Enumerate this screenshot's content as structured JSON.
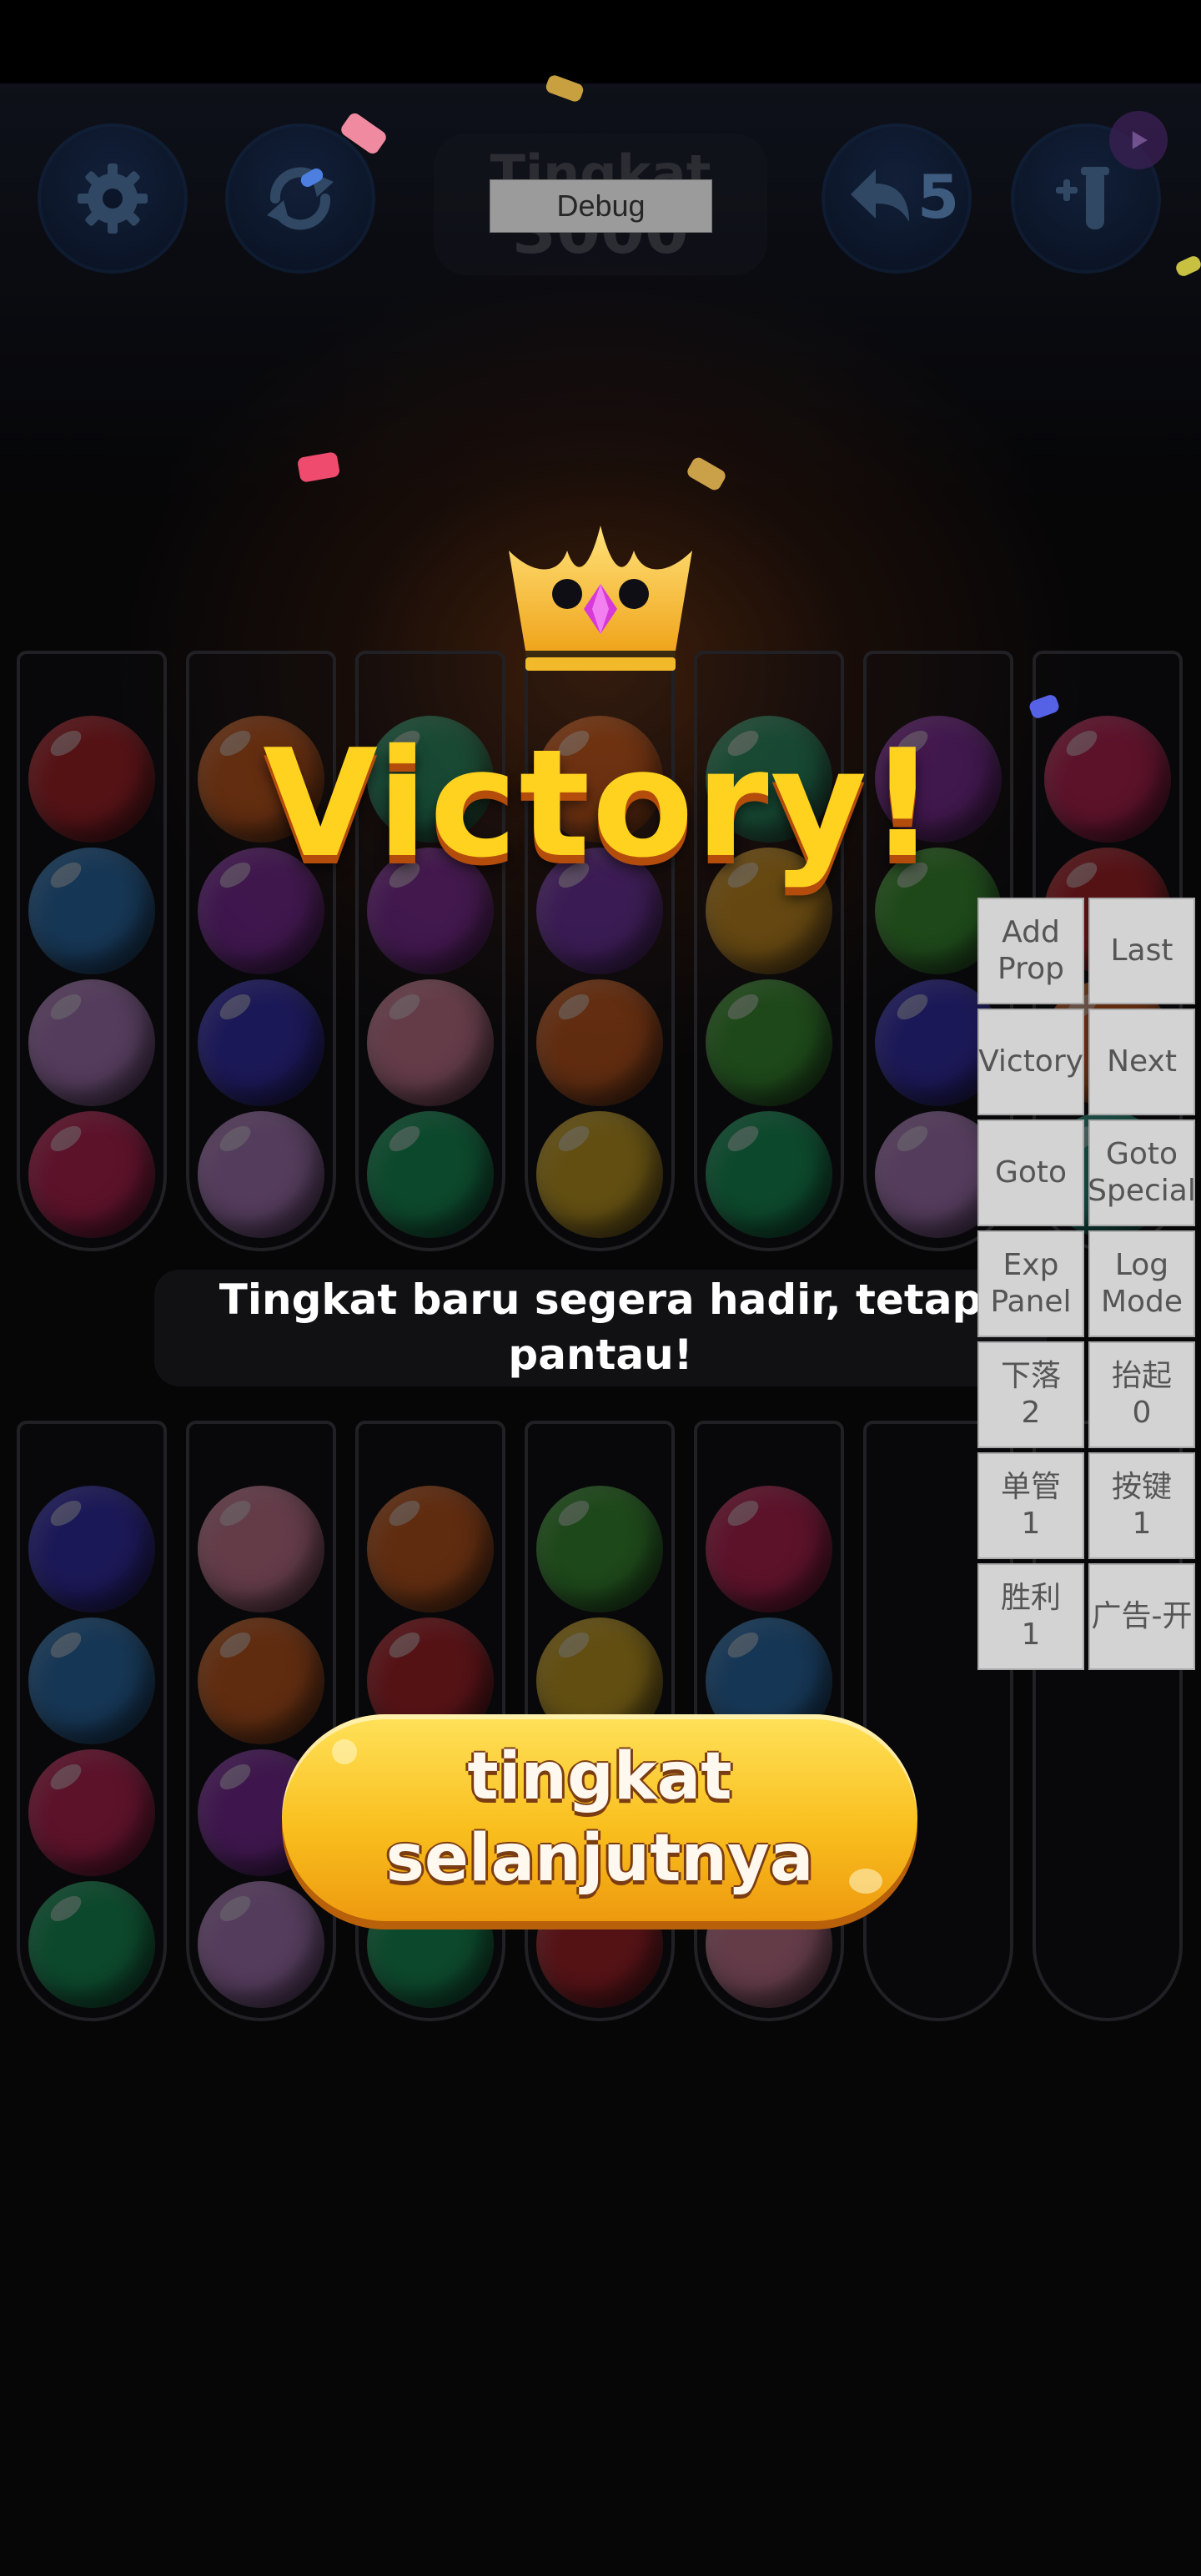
{
  "header": {
    "level_title": "Tingkat",
    "level_number": "3000",
    "undo_count": "5",
    "debug_label": "Debug",
    "icons": [
      "gear-icon",
      "restart-icon",
      "undo-icon",
      "add-tube-icon",
      "play-ad-icon"
    ]
  },
  "victory": {
    "title": "Victory!",
    "subtitle": "Tingkat baru segera hadir, tetap pantau!",
    "next_button": "tingkat selanjutnya"
  },
  "debug_panel": {
    "add_prop": "Add Prop",
    "last": "Last",
    "victory": "Victory",
    "next": "Next",
    "goto": "Goto",
    "goto_special": "Goto Special",
    "exp_panel": "Exp Panel",
    "log_mode": "Log Mode",
    "drop": "下落\n2",
    "lift": "抬起\n0",
    "single_tube": "单管\n1",
    "key": "按键\n1",
    "win": "胜利\n1",
    "ad_toggle": "广告-开"
  },
  "board": {
    "rows": [
      [
        [
          "#c6242a",
          "#2d7cc4",
          "#c58ad6",
          "#d7245a"
        ],
        [
          "#e0631c",
          "#8e2fb0",
          "#3a33c9",
          "#c58ad6"
        ],
        [
          "#1fa070",
          "#8e2fb0",
          "#e889a4",
          "#16a860"
        ],
        [
          "#e0631c",
          "#7a37c0",
          "#e0631c",
          "#e6b720"
        ],
        [
          "#1fa070",
          "#e3a21f",
          "#3fa733",
          "#16a860"
        ],
        [
          "#8e2fb0",
          "#3fa733",
          "#3a33c9",
          "#c58ad6"
        ],
        [
          "#d7245a",
          "#c6242a",
          "#e0631c",
          "#1f9f8a"
        ]
      ],
      [
        [
          "#3a33c9",
          "#2d7cc4",
          "#d7245a",
          "#16a860"
        ],
        [
          "#e889a4",
          "#e0631c",
          "#8e2fb0",
          "#c58ad6"
        ],
        [
          "#e0631c",
          "#c6242a",
          "#1fa070",
          "#16a860"
        ],
        [
          "#3fa733",
          "#e6b720",
          "#e3a21f",
          "#c6242a"
        ],
        [
          "#d7245a",
          "#2d7cc4",
          "#e889a4",
          "#e889a4"
        ],
        [],
        []
      ]
    ]
  },
  "colors": {
    "victory_text": "#ffd21f",
    "button_yellow": "#f9bf1e",
    "background": "#08080a"
  }
}
